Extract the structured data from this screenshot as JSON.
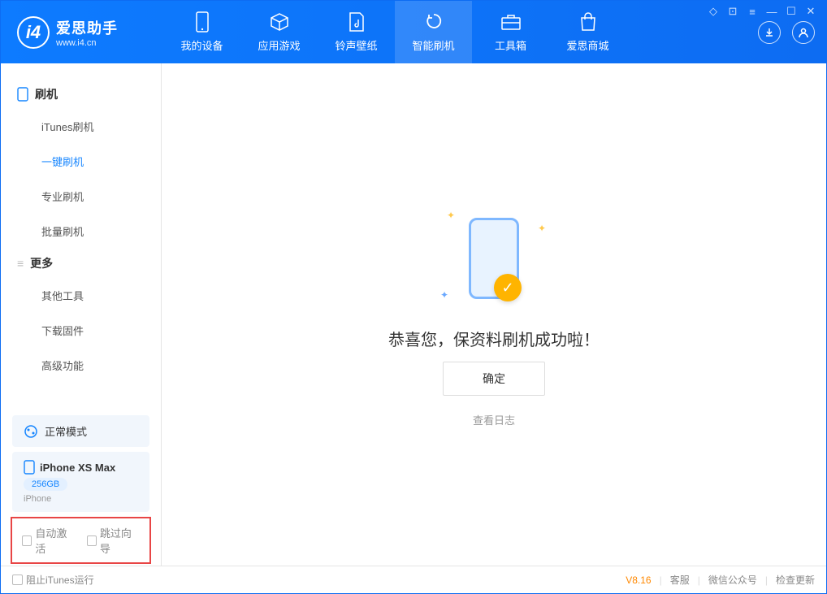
{
  "app": {
    "title": "爱思助手",
    "subtitle": "www.i4.cn"
  },
  "tabs": {
    "device": "我的设备",
    "apps": "应用游戏",
    "ringtone": "铃声壁纸",
    "flash": "智能刷机",
    "toolbox": "工具箱",
    "store": "爱思商城"
  },
  "sidebar": {
    "section_flash": "刷机",
    "items_flash": {
      "itunes": "iTunes刷机",
      "oneclick": "一键刷机",
      "pro": "专业刷机",
      "batch": "批量刷机"
    },
    "section_more": "更多",
    "items_more": {
      "othertools": "其他工具",
      "firmware": "下载固件",
      "advanced": "高级功能"
    },
    "status": "正常模式",
    "device": {
      "name": "iPhone XS Max",
      "capacity": "256GB",
      "type": "iPhone"
    },
    "checkbox_auto_activate": "自动激活",
    "checkbox_skip_guide": "跳过向导"
  },
  "main": {
    "success_message": "恭喜您，保资料刷机成功啦！",
    "confirm": "确定",
    "view_log": "查看日志"
  },
  "footer": {
    "block_itunes": "阻止iTunes运行",
    "version": "V8.16",
    "support": "客服",
    "wechat": "微信公众号",
    "update": "检查更新"
  }
}
